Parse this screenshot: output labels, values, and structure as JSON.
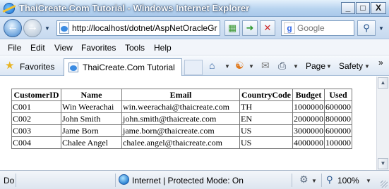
{
  "window": {
    "title": "ThaiCreate.Com Tutorial - Windows Internet Explorer",
    "minimize": "_",
    "maximize": "□",
    "close": "X"
  },
  "nav": {
    "address": "http://localhost/dotnet/AspNetOracleGr",
    "search_placeholder": "Google",
    "search_icon": "magnifier-icon"
  },
  "menu": [
    "File",
    "Edit",
    "View",
    "Favorites",
    "Tools",
    "Help"
  ],
  "favbar": {
    "favorites_label": "Favorites",
    "tab_label": "ThaiCreate.Com Tutorial",
    "page_label": "Page",
    "safety_label": "Safety",
    "more": "»"
  },
  "table": {
    "headers": [
      "CustomerID",
      "Name",
      "Email",
      "CountryCode",
      "Budget",
      "Used"
    ],
    "rows": [
      [
        "C001",
        "Win Weerachai",
        "win.weerachai@thaicreate.com",
        "TH",
        "1000000",
        "600000"
      ],
      [
        "C002",
        "John Smith",
        "john.smith@thaicreate.com",
        "EN",
        "2000000",
        "800000"
      ],
      [
        "C003",
        "Jame Born",
        "jame.born@thaicreate.com",
        "US",
        "3000000",
        "600000"
      ],
      [
        "C004",
        "Chalee Angel",
        "chalee.angel@thaicreate.com",
        "US",
        "4000000",
        "100000"
      ]
    ]
  },
  "status": {
    "left": "Do",
    "zone": "Internet | Protected Mode: On",
    "zoom": "100%"
  }
}
